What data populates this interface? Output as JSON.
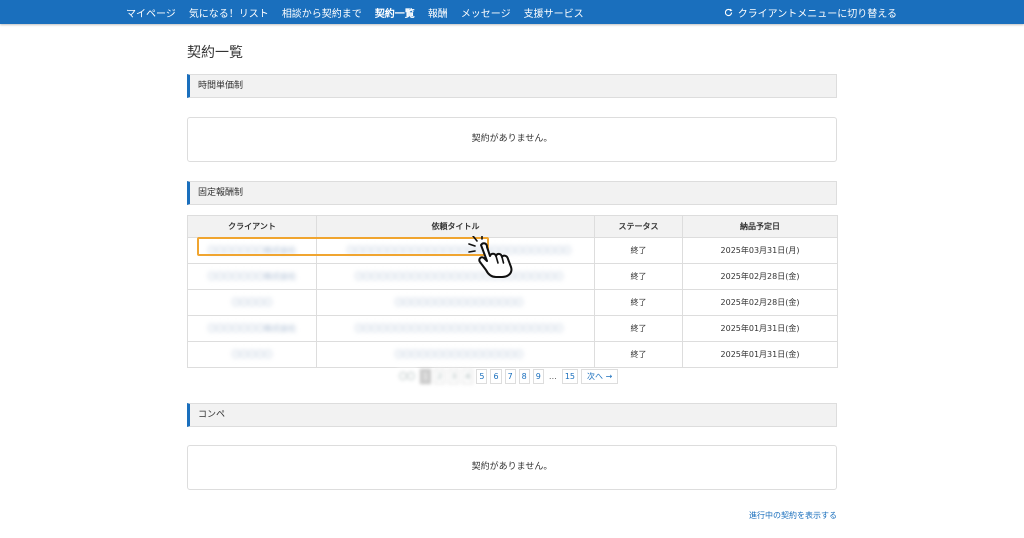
{
  "nav": {
    "items": [
      {
        "label": "マイページ",
        "active": false
      },
      {
        "label": "気になる！リスト",
        "active": false
      },
      {
        "label": "相談から契約まで",
        "active": false
      },
      {
        "label": "契約一覧",
        "active": true
      },
      {
        "label": "報酬",
        "active": false
      },
      {
        "label": "メッセージ",
        "active": false
      },
      {
        "label": "支援サービス",
        "active": false
      }
    ],
    "switch_label": "クライアントメニューに切り替える",
    "switch_icon": "refresh-icon",
    "bg_color": "#1a6fbd"
  },
  "page_title": "契約一覧",
  "sections": {
    "hourly": {
      "title": "時間単価制",
      "empty_message": "契約がありません。"
    },
    "fixed": {
      "title": "固定報酬制"
    },
    "competition": {
      "title": "コンペ",
      "empty_message": "契約がありません。"
    }
  },
  "table": {
    "headers": [
      "クライアント",
      "依頼タイトル",
      "ステータス",
      "納品予定日"
    ],
    "rows": [
      {
        "client": "〇〇〇〇〇〇〇株式会社",
        "title": "〇〇〇〇〇〇〇〇〇〇〇〇〇〇〇〇〇〇〇〇〇〇〇〇〇〇〇〇",
        "status": "終了",
        "date": "2025年03月31日(月)"
      },
      {
        "client": "〇〇〇〇〇〇〇株式会社",
        "title": "〇〇〇〇〇〇〇〇〇〇〇〇〇〇〇〇〇〇〇〇〇〇〇〇〇〇",
        "status": "終了",
        "date": "2025年02月28日(金)"
      },
      {
        "client": "〇〇〇〇〇",
        "title": "〇〇〇〇〇〇〇〇〇〇〇〇〇〇〇〇",
        "status": "終了",
        "date": "2025年02月28日(金)"
      },
      {
        "client": "〇〇〇〇〇〇〇株式会社",
        "title": "〇〇〇〇〇〇〇〇〇〇〇〇〇〇〇〇〇〇〇〇〇〇〇〇〇〇",
        "status": "終了",
        "date": "2025年01月31日(金)"
      },
      {
        "client": "〇〇〇〇〇",
        "title": "〇〇〇〇〇〇〇〇〇〇〇〇〇〇〇〇",
        "status": "終了",
        "date": "2025年01月31日(金)"
      }
    ]
  },
  "pagination": {
    "prev_label": "〇〇",
    "current": "1",
    "blurred_pages": [
      "2",
      "3",
      "4"
    ],
    "pages": [
      "5",
      "6",
      "7",
      "8",
      "9"
    ],
    "ellipsis": "…",
    "last": "15",
    "next_label": "次へ →"
  },
  "footer_link": "進行中の契約を表示する",
  "highlight_color": "#f0a530",
  "cursor_icon": "pointing-hand-cursor-icon"
}
